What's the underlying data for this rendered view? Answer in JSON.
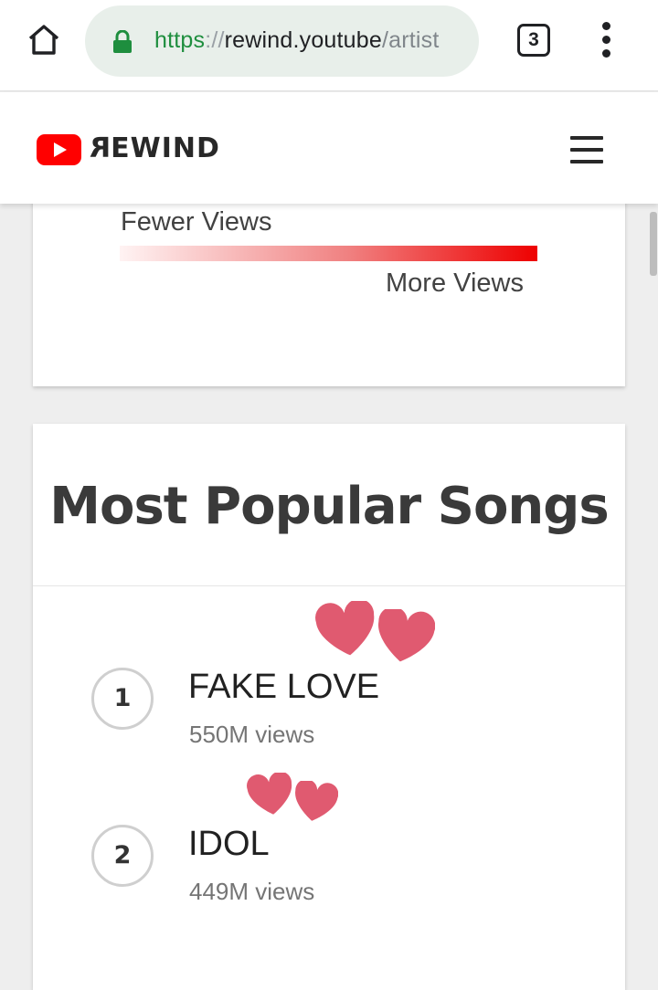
{
  "browser": {
    "url_scheme": "https",
    "url_sep": "://",
    "url_host": "rewind.youtube",
    "url_path": "/artist",
    "tab_count": "3",
    "icons": {
      "home": "home-icon",
      "lock": "lock-icon",
      "menu": "more-vert-icon"
    }
  },
  "site": {
    "brand": "REWIND",
    "brand_first": "R",
    "brand_rest": "EWIND",
    "menu_icon": "hamburger-menu-icon",
    "accent_color": "#ff0000"
  },
  "legend": {
    "fewer_label": "Fewer Views",
    "more_label": "More Views",
    "gradient_colors": [
      "#fff3f3",
      "#ee0000"
    ]
  },
  "songs": {
    "title": "Most Popular Songs",
    "items": [
      {
        "rank": "1",
        "name": "FAKE LOVE",
        "views": "550M views"
      },
      {
        "rank": "2",
        "name": "IDOL",
        "views": "449M views"
      }
    ],
    "heart_color": "#e05a70"
  }
}
